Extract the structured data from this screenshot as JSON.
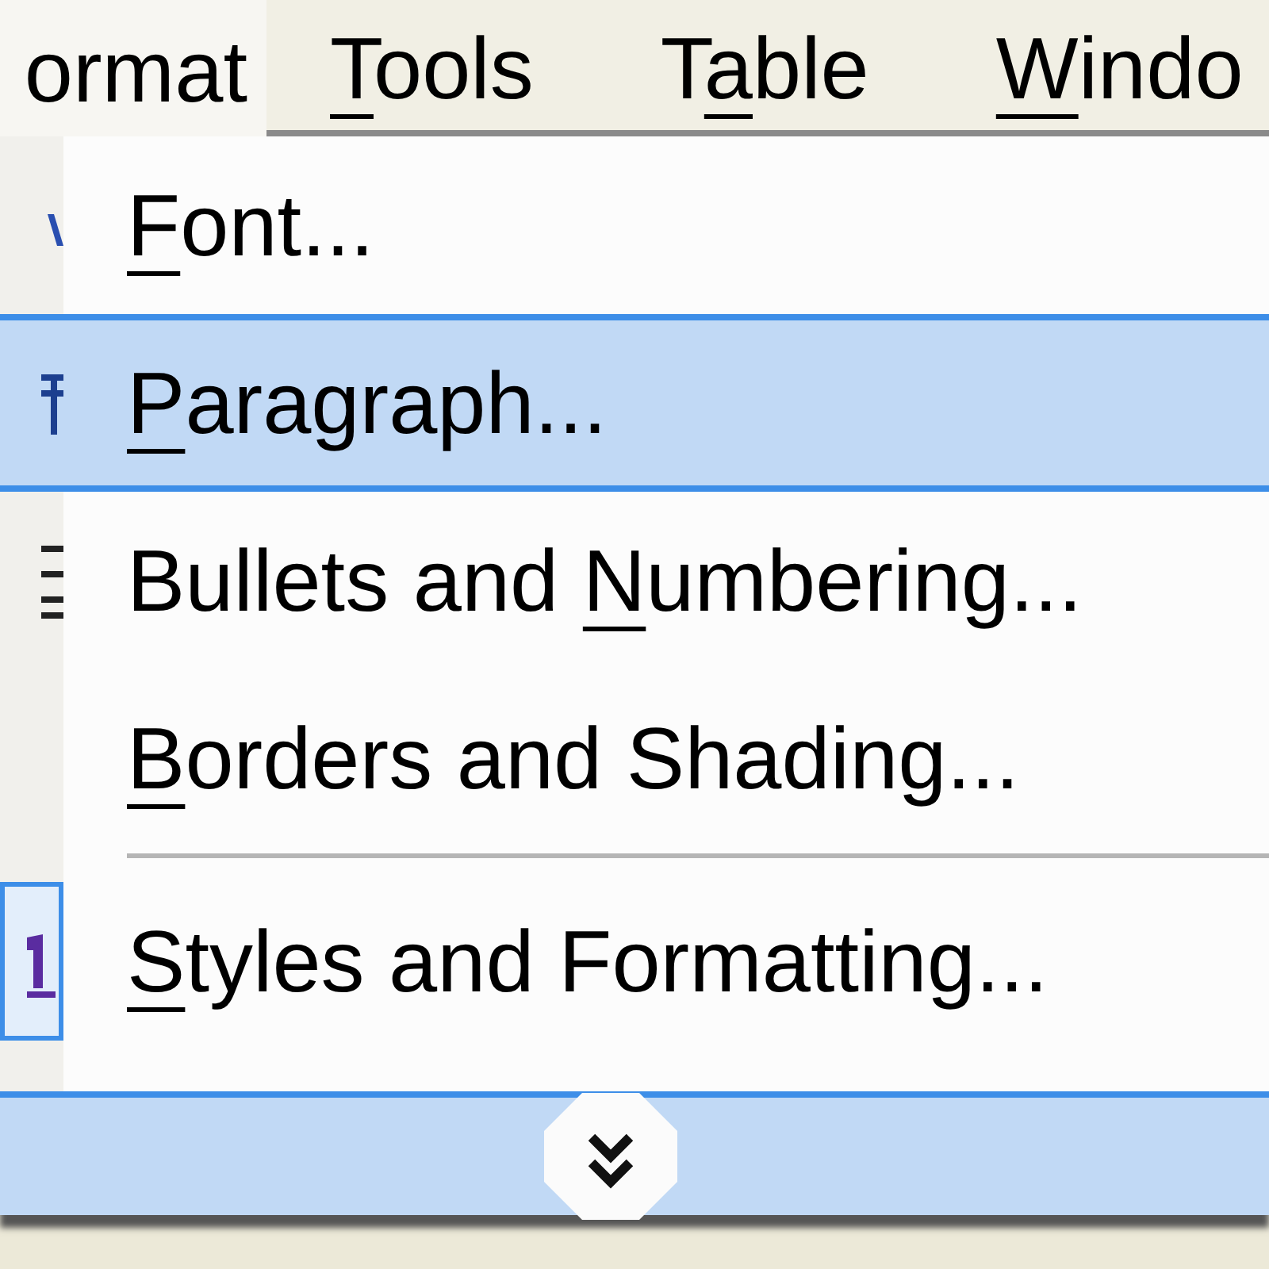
{
  "menu_bar": [
    {
      "label": {
        "after": "ormat"
      },
      "selected": true
    },
    {
      "label": {
        "key": "T",
        "after": "ools"
      },
      "selected": false
    },
    {
      "label": {
        "before": "T",
        "key": "a",
        "after": "ble"
      },
      "selected": false
    },
    {
      "label": {
        "key": "W",
        "after": "indo"
      },
      "selected": false
    }
  ],
  "menu": {
    "items": [
      {
        "kind": "command",
        "label": {
          "key": "F",
          "after": "ont..."
        },
        "selected": false,
        "checked": false
      },
      {
        "kind": "command",
        "label": {
          "key": "P",
          "after": "aragraph..."
        },
        "selected": true,
        "checked": false
      },
      {
        "kind": "command",
        "label": {
          "before": "Bullets and ",
          "key": "N",
          "after": "umbering..."
        },
        "selected": false,
        "checked": false
      },
      {
        "kind": "command",
        "label": {
          "key": "B",
          "after": "orders and Shading..."
        },
        "selected": false,
        "checked": false
      },
      {
        "kind": "separator"
      },
      {
        "kind": "command",
        "label": {
          "key": "S",
          "after": "tyles and Formatting..."
        },
        "selected": false,
        "checked": true
      }
    ],
    "expand": {
      "selected": true
    }
  }
}
